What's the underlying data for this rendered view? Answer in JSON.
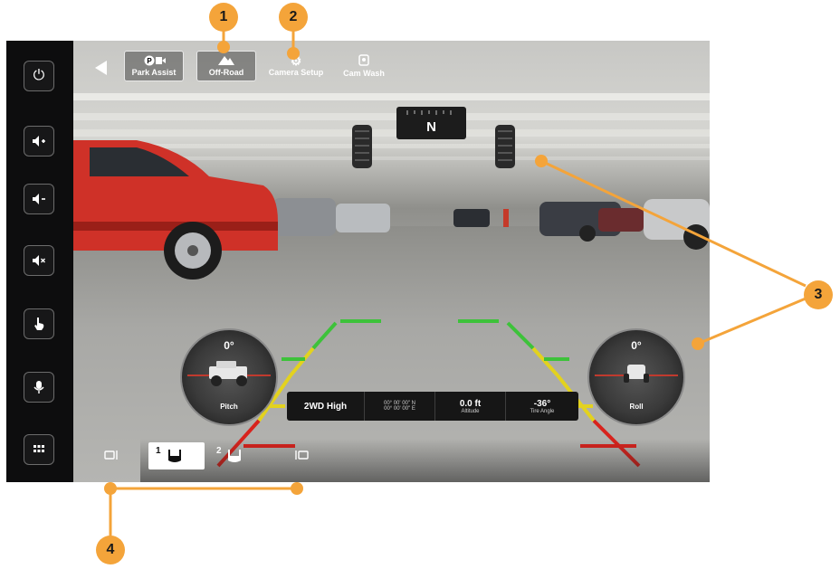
{
  "top_bar": {
    "park_assist_label": "Park Assist",
    "off_road_label": "Off-Road",
    "camera_setup_label": "Camera Setup",
    "cam_wash_label": "Cam Wash"
  },
  "compass": {
    "heading": "N"
  },
  "gauges": {
    "pitch": {
      "value": "0°",
      "label": "Pitch"
    },
    "roll": {
      "value": "0°",
      "label": "Roll"
    }
  },
  "info_bar": {
    "drive_mode": "2WD High",
    "latitude": "00° 00' 00\" N",
    "longitude": "00° 00' 00\" E",
    "altitude_value": "0.0 ft",
    "altitude_label": "Altitude",
    "tire_angle_value": "-36°",
    "tire_angle_label": "Tire Angle"
  },
  "view_selector": {
    "view_1_number": "1",
    "view_2_number": "2"
  },
  "callouts": [
    "1",
    "2",
    "3",
    "4"
  ],
  "colors": {
    "callout": "#f4a43a",
    "guide_green": "#3dc23a",
    "guide_yellow": "#e3d21e",
    "guide_red": "#d8231d"
  }
}
